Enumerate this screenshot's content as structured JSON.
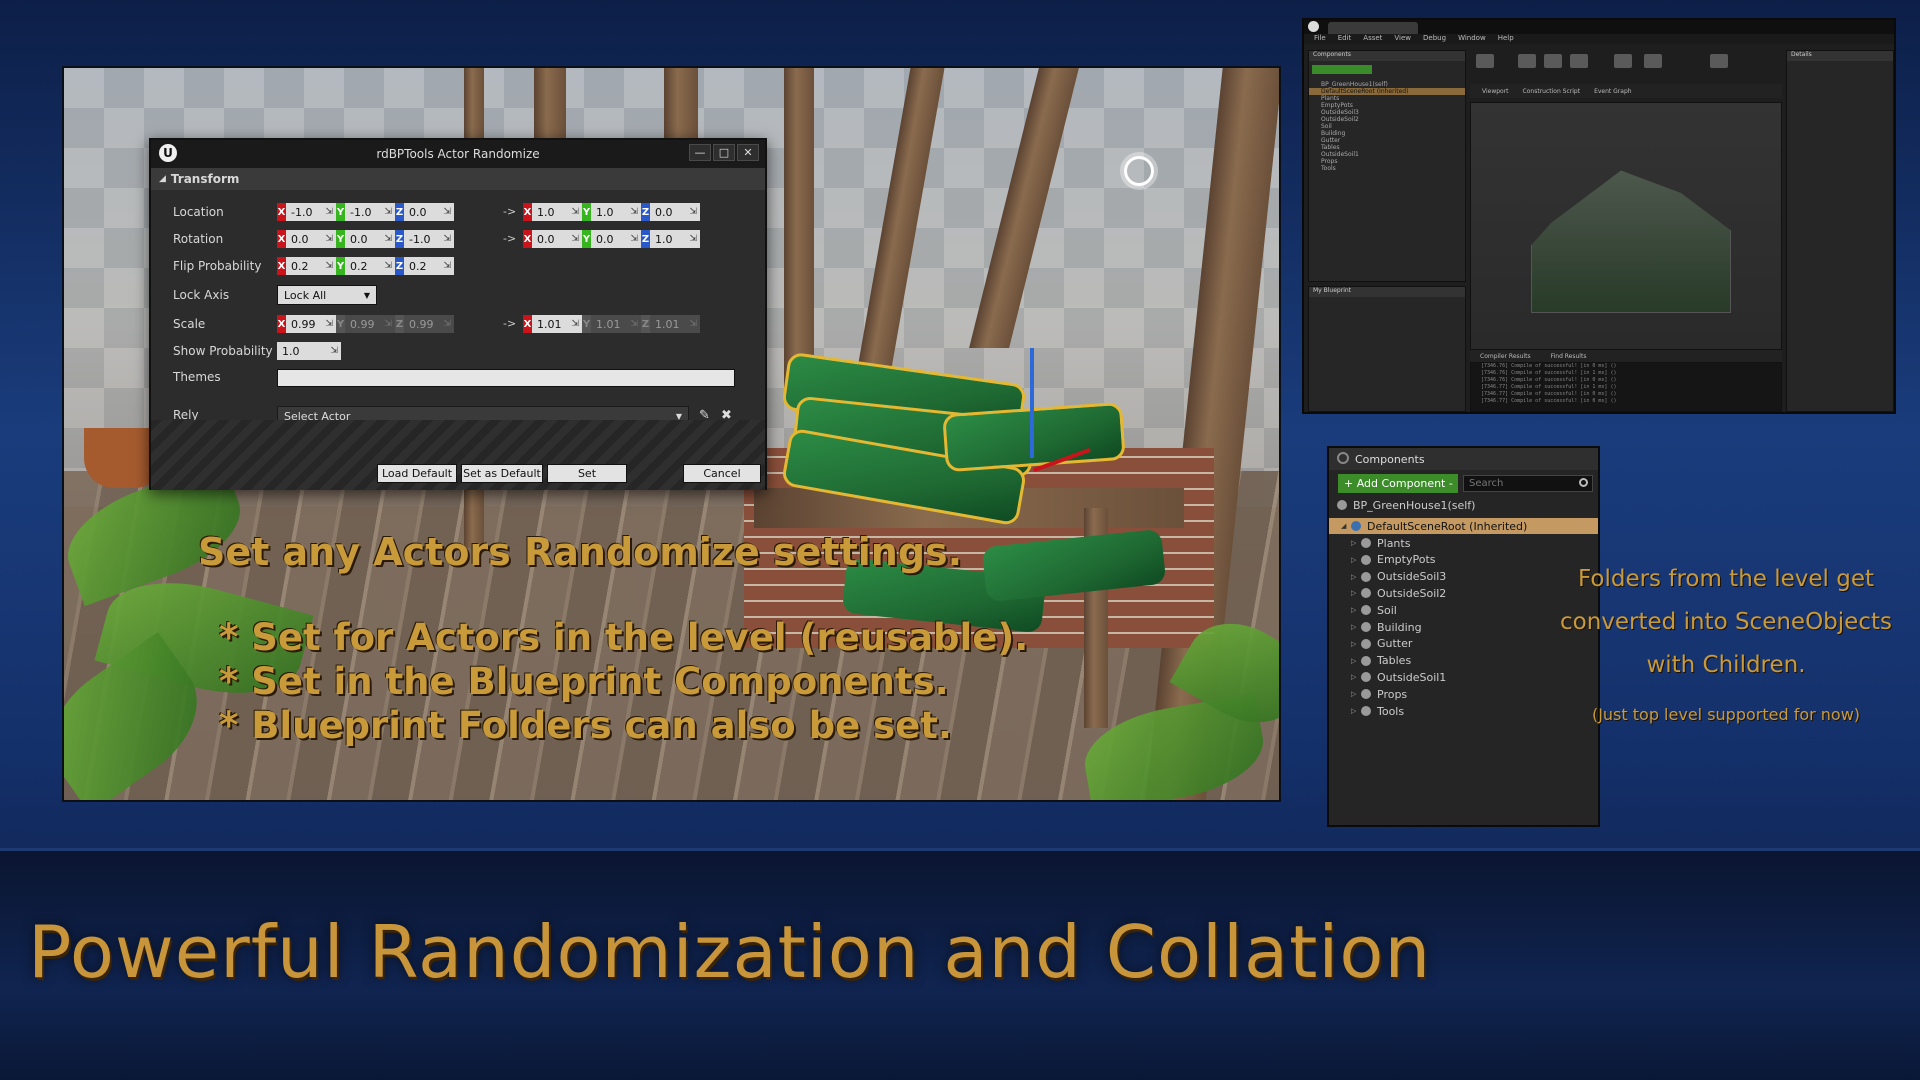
{
  "headline": "Powerful Randomization and Collation",
  "overlay": {
    "line1": "Set any Actors Randomize settings.",
    "line2": "* Set for Actors in the level (reusable).",
    "line3": "* Set in the Blueprint Components.",
    "line4": "* Blueprint Folders can also be set."
  },
  "dialog": {
    "title": "rdBPTools Actor Randomize",
    "section": "Transform",
    "labels": {
      "location": "Location",
      "rotation": "Rotation",
      "flip": "Flip Probability",
      "lock": "Lock Axis",
      "scale": "Scale",
      "show": "Show Probability",
      "themes": "Themes",
      "rely": "Rely"
    },
    "location_min": [
      "-1.0",
      "-1.0",
      "0.0"
    ],
    "location_max": [
      "1.0",
      "1.0",
      "0.0"
    ],
    "rotation_min": [
      "0.0",
      "0.0",
      "-1.0"
    ],
    "rotation_max": [
      "0.0",
      "0.0",
      "1.0"
    ],
    "flip": [
      "0.2",
      "0.2",
      "0.2"
    ],
    "lock_axis": "Lock All",
    "scale_min": [
      "0.99",
      "0.99",
      "0.99"
    ],
    "scale_max": [
      "1.01",
      "1.01",
      "1.01"
    ],
    "show_probability": "1.0",
    "rely_placeholder": "Select Actor",
    "arrow": "->",
    "buttons": {
      "load": "Load Default",
      "set_default": "Set as Default",
      "set": "Set",
      "cancel": "Cancel"
    },
    "axis_letters": [
      "X",
      "Y",
      "Z"
    ]
  },
  "components_panel": {
    "title": "Components",
    "add_button": "+ Add Component -",
    "search_placeholder": "Search",
    "self_item": "BP_GreenHouse1(self)",
    "root": "DefaultSceneRoot (Inherited)",
    "children": [
      "Plants",
      "EmptyPots",
      "OutsideSoil3",
      "OutsideSoil2",
      "Soil",
      "Building",
      "Gutter",
      "Tables",
      "OutsideSoil1",
      "Props",
      "Tools"
    ]
  },
  "note": {
    "line1": "Folders from the level get",
    "line2": "converted into SceneObjects",
    "line3": "with Children.",
    "line4": "(Just top level supported for now)"
  },
  "editor": {
    "menu": [
      "File",
      "Edit",
      "Asset",
      "View",
      "Debug",
      "Window",
      "Help"
    ],
    "tabs": [
      "Viewport",
      "Construction Script",
      "Event Graph"
    ],
    "panels": [
      "Components",
      "My Blueprint",
      "Details",
      "Compiler Results",
      "Find Results"
    ],
    "log_lines": [
      "[7346.76] Compile of  successful! [in 0 ms] ()",
      "[7346.76] Compile of  successful! [in 1 ms] ()",
      "[7346.76] Compile of  successful! [in 0 ms] ()",
      "[7346.77] Compile of  successful! [in 1 ms] ()",
      "[7346.77] Compile of  successful! [in 0 ms] ()",
      "[7346.77] Compile of  successful! [in 0 ms] ()"
    ]
  },
  "colors": {
    "accent_gold": "#c89a3a",
    "axis_x": "#c8141a",
    "axis_y": "#36b51e",
    "axis_z": "#2a58c8",
    "add_green": "#3c8d2a",
    "selection": "#c49a62"
  }
}
